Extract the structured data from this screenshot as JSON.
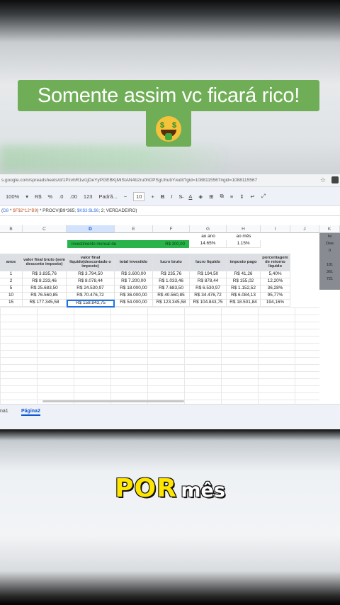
{
  "caption": {
    "title": "Somente assim vc ficará rico!",
    "emoji": "money-mouth-face"
  },
  "browser": {
    "url": "s.google.com/spreadsheets/d/1PzvhR1w1jDeYyPGEBKjMiStAN4b2ru0hDPSgUhubY/edit?gid=1088115567#gid=1088115567"
  },
  "toolbar": {
    "zoom": "100%",
    "currency": "R$",
    "percent": "%",
    "dec_dec": ".0",
    "dec_inc": ".00",
    "format_num": "123",
    "font": "Padrã...",
    "minus": "−",
    "font_size": "10",
    "plus": "+",
    "bold": "B",
    "italic": "I",
    "strike": "S̶",
    "text_color": "A"
  },
  "formula_bar": {
    "part1": "(",
    "ref1": "D8",
    "part2": " * ",
    "ref2": "$F$2*12*B9",
    "part3": ") * PROCV(B9*365; ",
    "ref3": "$K$3:$L$6",
    "part4": "; 2; VERDADEIRO)"
  },
  "columns": [
    "B",
    "C",
    "D",
    "E",
    "F",
    "G",
    "H",
    "I",
    "J",
    "K"
  ],
  "summary": {
    "label_year": "ao ano",
    "label_month": "ao mês",
    "value_year": "14.65%",
    "value_month": "1.15%",
    "green_label": "investimento mensal de",
    "green_value": "R$ 300,00"
  },
  "table": {
    "headers": [
      "anos",
      "valor final bruto (sem desconto imposto)",
      "valor final liquido(descontado o imposto)",
      "total investido",
      "lucro bruto",
      "lucro liquido",
      "imposto pago",
      "porcentagem de retorno liquido"
    ],
    "rows": [
      [
        "1",
        "R$ 3.835,76",
        "R$ 3.794,50",
        "R$ 3.600,00",
        "R$ 235,76",
        "R$ 194,50",
        "R$ 41,26",
        "5,40%"
      ],
      [
        "2",
        "R$ 8.233,46",
        "R$ 8.078,44",
        "R$ 7.200,00",
        "R$ 1.033,46",
        "R$ 878,44",
        "R$ 155,02",
        "12,20%"
      ],
      [
        "5",
        "R$ 25.683,50",
        "R$ 24.530,97",
        "R$ 18.000,00",
        "R$ 7.683,50",
        "R$ 6.530,97",
        "R$ 1.152,52",
        "36,28%"
      ],
      [
        "10",
        "R$ 76.560,85",
        "R$ 70.476,72",
        "R$ 36.000,00",
        "R$ 40.560,85",
        "R$ 34.476,72",
        "R$ 6.084,13",
        "95,77%"
      ],
      [
        "15",
        "R$ 177.345,58",
        "R$ 158.843,75",
        "R$ 54.000,00",
        "R$ 123.345,58",
        "R$ 104.843,75",
        "R$ 18.501,84",
        "194,16%"
      ]
    ]
  },
  "right_panel": [
    "Isi",
    "Dias",
    "0",
    "",
    "181",
    "361",
    "721"
  ],
  "tabs": {
    "sheet1": "na1",
    "sheet2": "Página2"
  },
  "subtitle": {
    "word1": "POR",
    "word2": "mês"
  }
}
